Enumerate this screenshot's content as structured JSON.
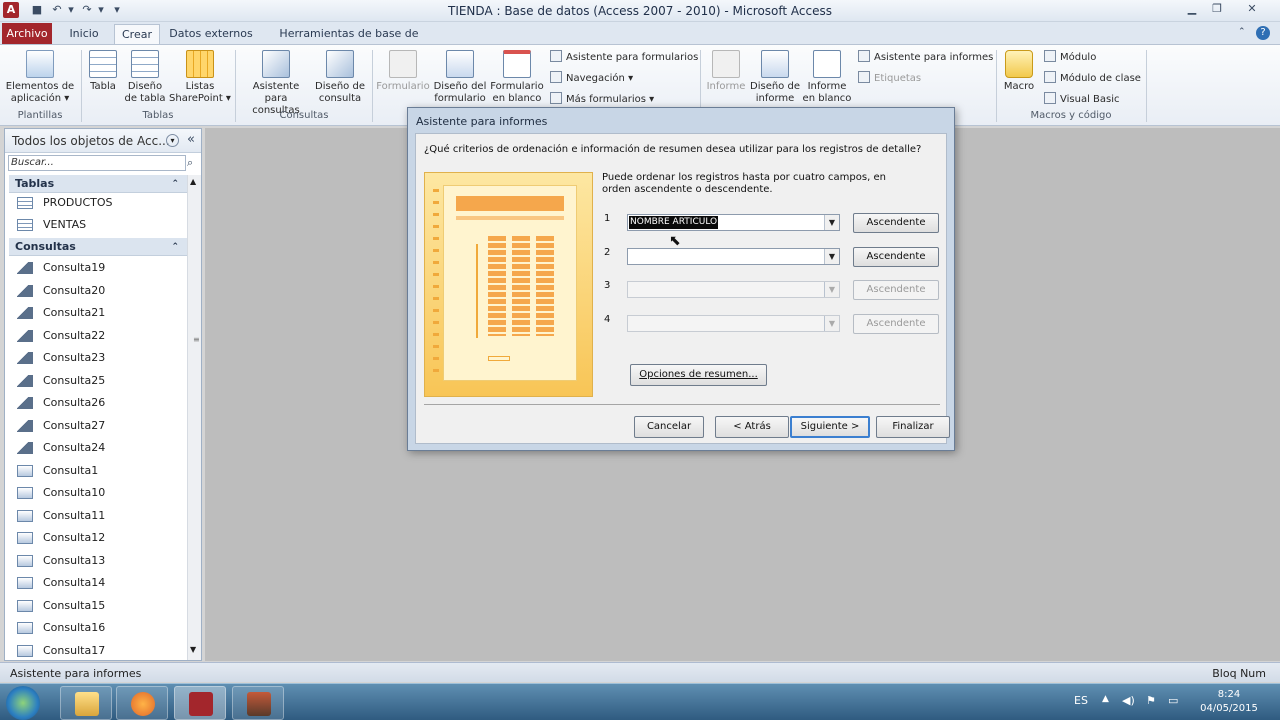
{
  "window": {
    "title": "TIENDA : Base de datos (Access 2007 - 2010)  -  Microsoft Access",
    "app_icon_letter": "A"
  },
  "tabs": [
    "Archivo",
    "Inicio",
    "Crear",
    "Datos externos",
    "Herramientas de base de datos"
  ],
  "ribbon": {
    "plantillas": {
      "btn": "Elementos de aplicación ▾",
      "label": "Plantillas"
    },
    "tablas": {
      "tabla": "Tabla",
      "diseno_tabla": "Diseño de tabla",
      "listas": "Listas SharePoint ▾",
      "label": "Tablas"
    },
    "consultas": {
      "asistente": "Asistente para consultas",
      "diseno": "Diseño de consulta",
      "label": "Consultas"
    },
    "formularios": {
      "formulario": "Formulario",
      "diseno": "Diseño del formulario",
      "blanco": "Formulario en blanco",
      "asistente": "Asistente para formularios",
      "navegacion": "Navegación ▾",
      "mas": "Más formularios ▾"
    },
    "informes": {
      "informe": "Informe",
      "diseno": "Diseño de informe",
      "blanco": "Informe en blanco",
      "asistente": "Asistente para informes",
      "etiquetas": "Etiquetas"
    },
    "macros": {
      "macro": "Macro",
      "modulo": "Módulo",
      "modulo_clase": "Módulo de clase",
      "vb": "Visual Basic",
      "label": "Macros y código"
    }
  },
  "nav": {
    "title": "Todos los objetos de Acc...",
    "search_placeholder": "Buscar...",
    "sections": [
      {
        "label": "Tablas",
        "items": [
          "PRODUCTOS",
          "VENTAS"
        ]
      },
      {
        "label": "Consultas",
        "items": [
          "Consulta19",
          "Consulta20",
          "Consulta21",
          "Consulta22",
          "Consulta23",
          "Consulta25",
          "Consulta26",
          "Consulta27",
          "Consulta24",
          "Consulta1",
          "Consulta10",
          "Consulta11",
          "Consulta12",
          "Consulta13",
          "Consulta14",
          "Consulta15",
          "Consulta16",
          "Consulta17"
        ]
      }
    ]
  },
  "dialog": {
    "title": "Asistente para informes",
    "question": "¿Qué criterios de ordenación e información de resumen desea utilizar para los registros de detalle?",
    "description": "Puede ordenar los registros hasta por cuatro campos, en orden ascendente o descendente.",
    "sort_rows": [
      {
        "num": "1",
        "value": "NOMBRE ARTICULO",
        "order": "Ascendente"
      },
      {
        "num": "2",
        "value": "",
        "order": "Ascendente"
      },
      {
        "num": "3",
        "value": "",
        "order": "Ascendente"
      },
      {
        "num": "4",
        "value": "",
        "order": "Ascendente"
      }
    ],
    "summary_button": "Opciones de resumen...",
    "buttons": {
      "cancel": "Cancelar",
      "back": "< Atrás",
      "next": "Siguiente >",
      "finish": "Finalizar"
    }
  },
  "status": {
    "left": "Asistente para informes",
    "right": "Bloq Num"
  },
  "taskbar": {
    "lang": "ES",
    "time": "8:24",
    "date": "04/05/2015"
  }
}
